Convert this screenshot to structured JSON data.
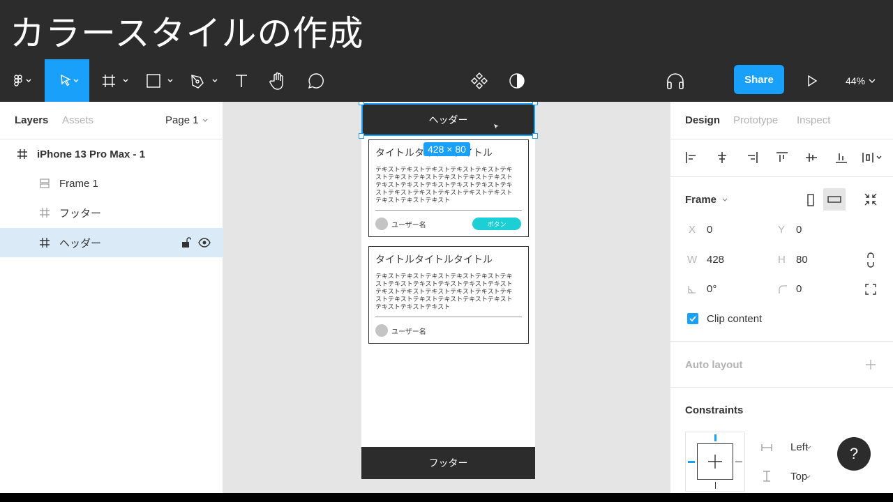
{
  "title": "カラースタイルの作成",
  "toolbar": {
    "share": "Share",
    "zoom": "44%"
  },
  "layers_panel": {
    "tabs": [
      "Layers",
      "Assets"
    ],
    "page": "Page 1",
    "items": [
      {
        "label": "iPhone 13 Pro Max - 1"
      },
      {
        "label": "Frame 1"
      },
      {
        "label": "フッター"
      },
      {
        "label": "ヘッダー"
      }
    ]
  },
  "canvas": {
    "header_text": "ヘッダー",
    "footer_text": "フッター",
    "size_badge": "428 × 80",
    "cards": [
      {
        "title": "タイトルタイトルタイトル",
        "body": "テキストテキストテキストテキストテキストテキストテキストテキストテキストテキストテキストテキストテキストテキストテキストテキストテキストテキストテキストテキストテキストテキストテキストテキストテキスト",
        "user": "ユーザー名",
        "button": "ボタン"
      },
      {
        "title": "タイトルタイトルタイトル",
        "body": "テキストテキストテキストテキストテキストテキストテキストテキストテキストテキストテキストテキストテキストテキストテキストテキストテキストテキストテキストテキストテキストテキストテキストテキストテキスト",
        "user": "ユーザー名"
      }
    ]
  },
  "design_panel": {
    "tabs": [
      "Design",
      "Prototype",
      "Inspect"
    ],
    "frame_label": "Frame",
    "x_label": "X",
    "x": "0",
    "y_label": "Y",
    "y": "0",
    "w_label": "W",
    "w": "428",
    "h_label": "H",
    "h": "80",
    "rotation": "0°",
    "radius": "0",
    "clip_content": "Clip content",
    "auto_layout": "Auto layout",
    "constraints": "Constraints",
    "constraint_h": "Left",
    "constraint_v": "Top"
  },
  "help": "?",
  "colors": {
    "accent": "#18a0fb",
    "dark": "#2c2c2c",
    "button": "#1ccfd4"
  }
}
